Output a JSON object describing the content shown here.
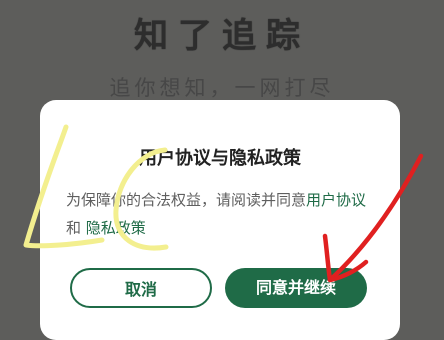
{
  "background": {
    "title": "知了追踪",
    "subtitle": "追你想知，一网打尽"
  },
  "dialog": {
    "title": "用户协议与隐私政策",
    "body_prefix": "为保障你的合法权益，请阅读并同意",
    "user_agreement_link": "用户协议",
    "conjunction": " 和 ",
    "privacy_policy_link": "隐私政策",
    "cancel_label": "取消",
    "agree_label": "同意并继续"
  },
  "colors": {
    "accent": "#1f6b47",
    "overlay": "#5d5d5b",
    "annotation_yellow": "#f3ef8f",
    "annotation_red": "#e02020"
  }
}
